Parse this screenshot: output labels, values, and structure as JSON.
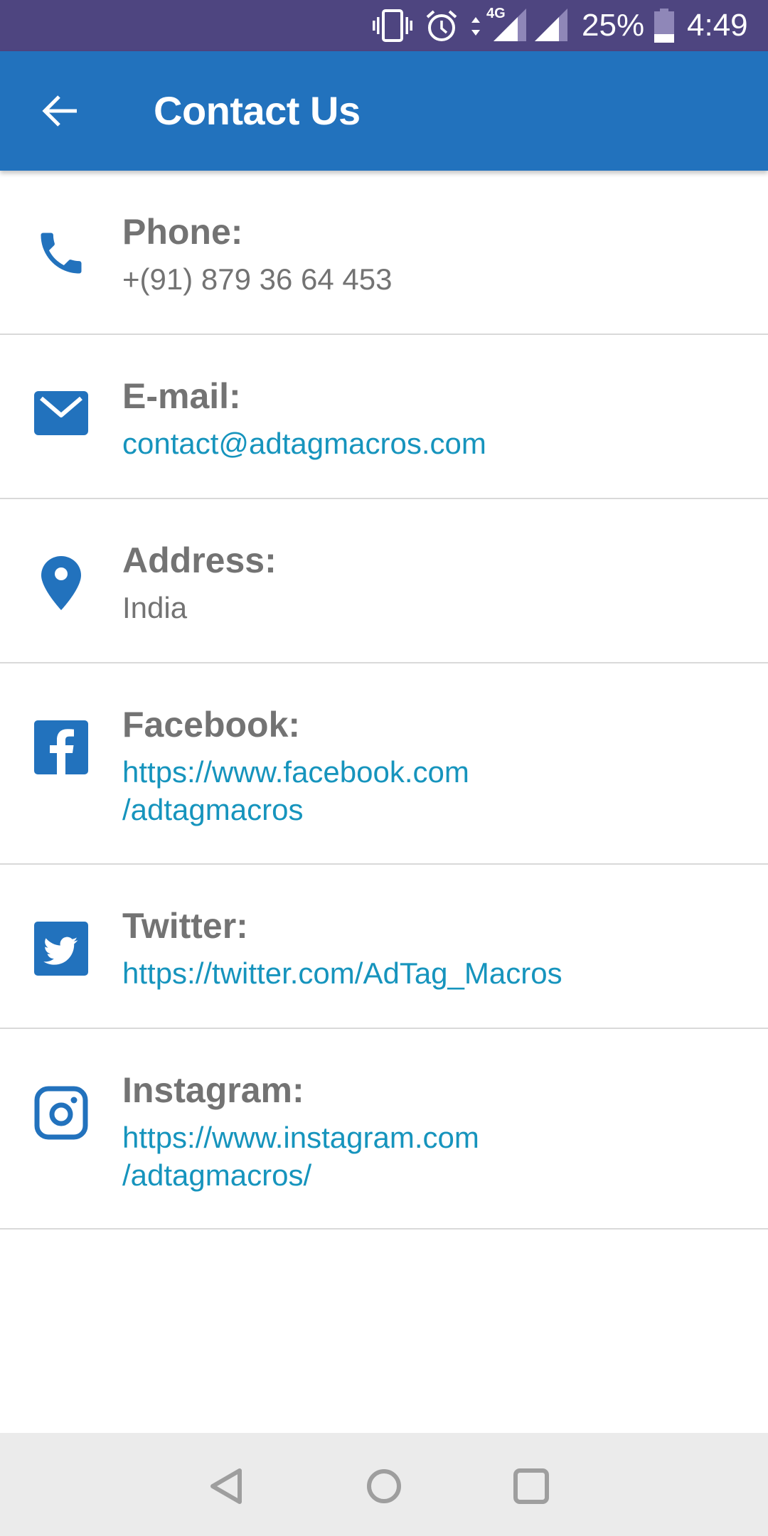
{
  "status_bar": {
    "icons": [
      "vibrate-icon",
      "alarm-icon",
      "data-arrows-icon",
      "signal-4g-icon",
      "signal-icon",
      "battery-icon"
    ],
    "network_label": "4G",
    "battery_percent": "25%",
    "time": "4:49",
    "background_color": "#4e4580"
  },
  "app_bar": {
    "back_icon": "arrow-left-icon",
    "title": "Contact Us",
    "background_color": "#2272bd"
  },
  "contacts": [
    {
      "id": "phone",
      "icon": "phone-icon",
      "label": "Phone:",
      "value_lines": [
        "+(91) 879 36 64 453"
      ],
      "is_link": false
    },
    {
      "id": "email",
      "icon": "mail-icon",
      "label": "E-mail:",
      "value_lines": [
        "contact@adtagmacros.com"
      ],
      "is_link": true
    },
    {
      "id": "address",
      "icon": "location-pin-icon",
      "label": "Address:",
      "value_lines": [
        "India"
      ],
      "is_link": false
    },
    {
      "id": "facebook",
      "icon": "facebook-icon",
      "label": "Facebook:",
      "value_lines": [
        "https://www.facebook.com",
        "/adtagmacros"
      ],
      "is_link": true
    },
    {
      "id": "twitter",
      "icon": "twitter-icon",
      "label": "Twitter:",
      "value_lines": [
        "https://twitter.com/AdTag_Macros"
      ],
      "is_link": true
    },
    {
      "id": "instagram",
      "icon": "instagram-icon",
      "label": "Instagram:",
      "value_lines": [
        "https://www.instagram.com",
        "/adtagmacros/"
      ],
      "is_link": true
    }
  ],
  "colors": {
    "icon_blue": "#2272bd",
    "label_gray": "#737373",
    "link_teal": "#1694bd",
    "divider": "#d9d9d9",
    "nav_bar_bg": "#ebebeb",
    "nav_icon": "#9e9e9e"
  },
  "nav_bar": {
    "buttons": [
      "back",
      "home",
      "recents"
    ]
  }
}
